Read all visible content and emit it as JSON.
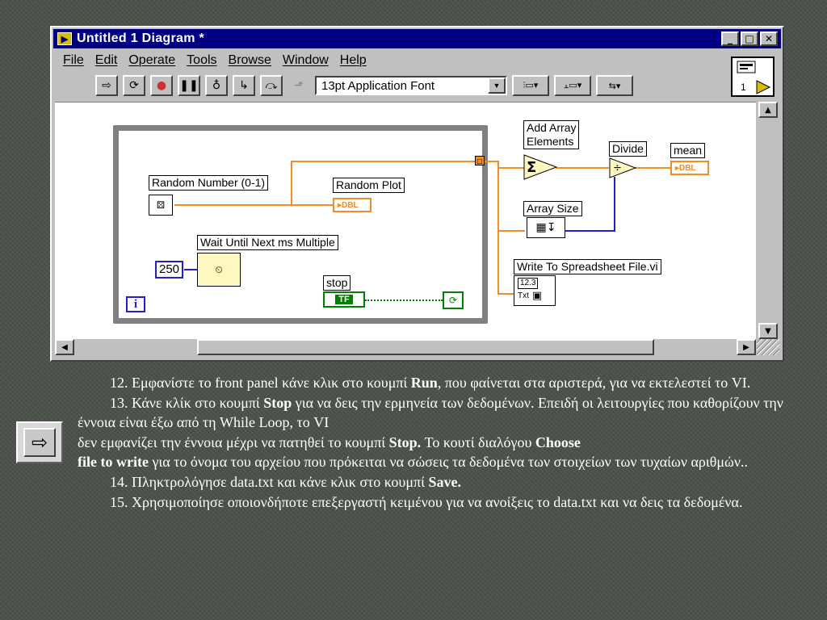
{
  "window": {
    "title": "Untitled 1 Diagram *",
    "controls": {
      "minimize": "_",
      "maximize": "□",
      "close": "✕"
    }
  },
  "menu": [
    "File",
    "Edit",
    "Operate",
    "Tools",
    "Browse",
    "Window",
    "Help"
  ],
  "toolbar": {
    "font": "13pt Application Font",
    "vi_icon_label": "1"
  },
  "diagram": {
    "labels": {
      "random_number": "Random Number (0-1)",
      "random_plot": "Random Plot",
      "wait": "Wait Until Next ms Multiple",
      "wait_value": "250",
      "stop": "stop",
      "stop_terminal": "TF",
      "iteration": "i",
      "tunnel": "□",
      "add_array": "Add Array\nElements",
      "add_array_symbol": "Σ",
      "array_size": "Array Size",
      "divide": "Divide",
      "mean": "mean",
      "write_file": "Write To Spreadsheet File.vi",
      "numeric_indicator": "DBL",
      "spreadsheet_format": "12.3",
      "spreadsheet_txt": "Txt"
    }
  },
  "instructions": [
    {
      "num": "12.",
      "text_a": " Εμφανίστε το front panel κάνε κλικ στο κουμπί ",
      "bold_a": "Run",
      "text_b": ", που φαίνεται στα αριστερά, για να εκτελεστεί το VI."
    },
    {
      "num": "13.",
      "text_a": " Κάνε κλίκ στο κουμπί ",
      "bold_a": "Stop",
      "text_b": " για να δεις την ερμηνεία των δεδομένων. Επειδή οι λειτουργίες που καθορίζουν την έννοια είναι έξω από τη While Loop, το VI",
      "text_c": "δεν εμφανίζει την έννοια μέχρι να πατηθεί το κουμπί ",
      "bold_b": "Stop.",
      "text_d": " Το κουτί διαλόγου ",
      "bold_c": "Choose",
      "bold_d": "file to write",
      "text_e": " για το όνομα του αρχείου που πρόκειται να σώσεις τα δεδομένα των στοιχείων των τυχαίων αριθμών.."
    },
    {
      "num": "14.",
      "text_a": " Πληκτρολόγησε data.txt και κάνε κλικ στο κουμπί ",
      "bold_a": "Save."
    },
    {
      "num": "15.",
      "text_a": " Χρησιμοποίησε οποιονδήποτε επεξεργαστή κειμένου για να ανοίξεις το data.txt και να δεις τα δεδομένα."
    }
  ],
  "colors": {
    "background": "#4a5249",
    "titlebar": "#000080",
    "wire_orange": "#f28c28",
    "wire_blue": "#2020d0"
  }
}
